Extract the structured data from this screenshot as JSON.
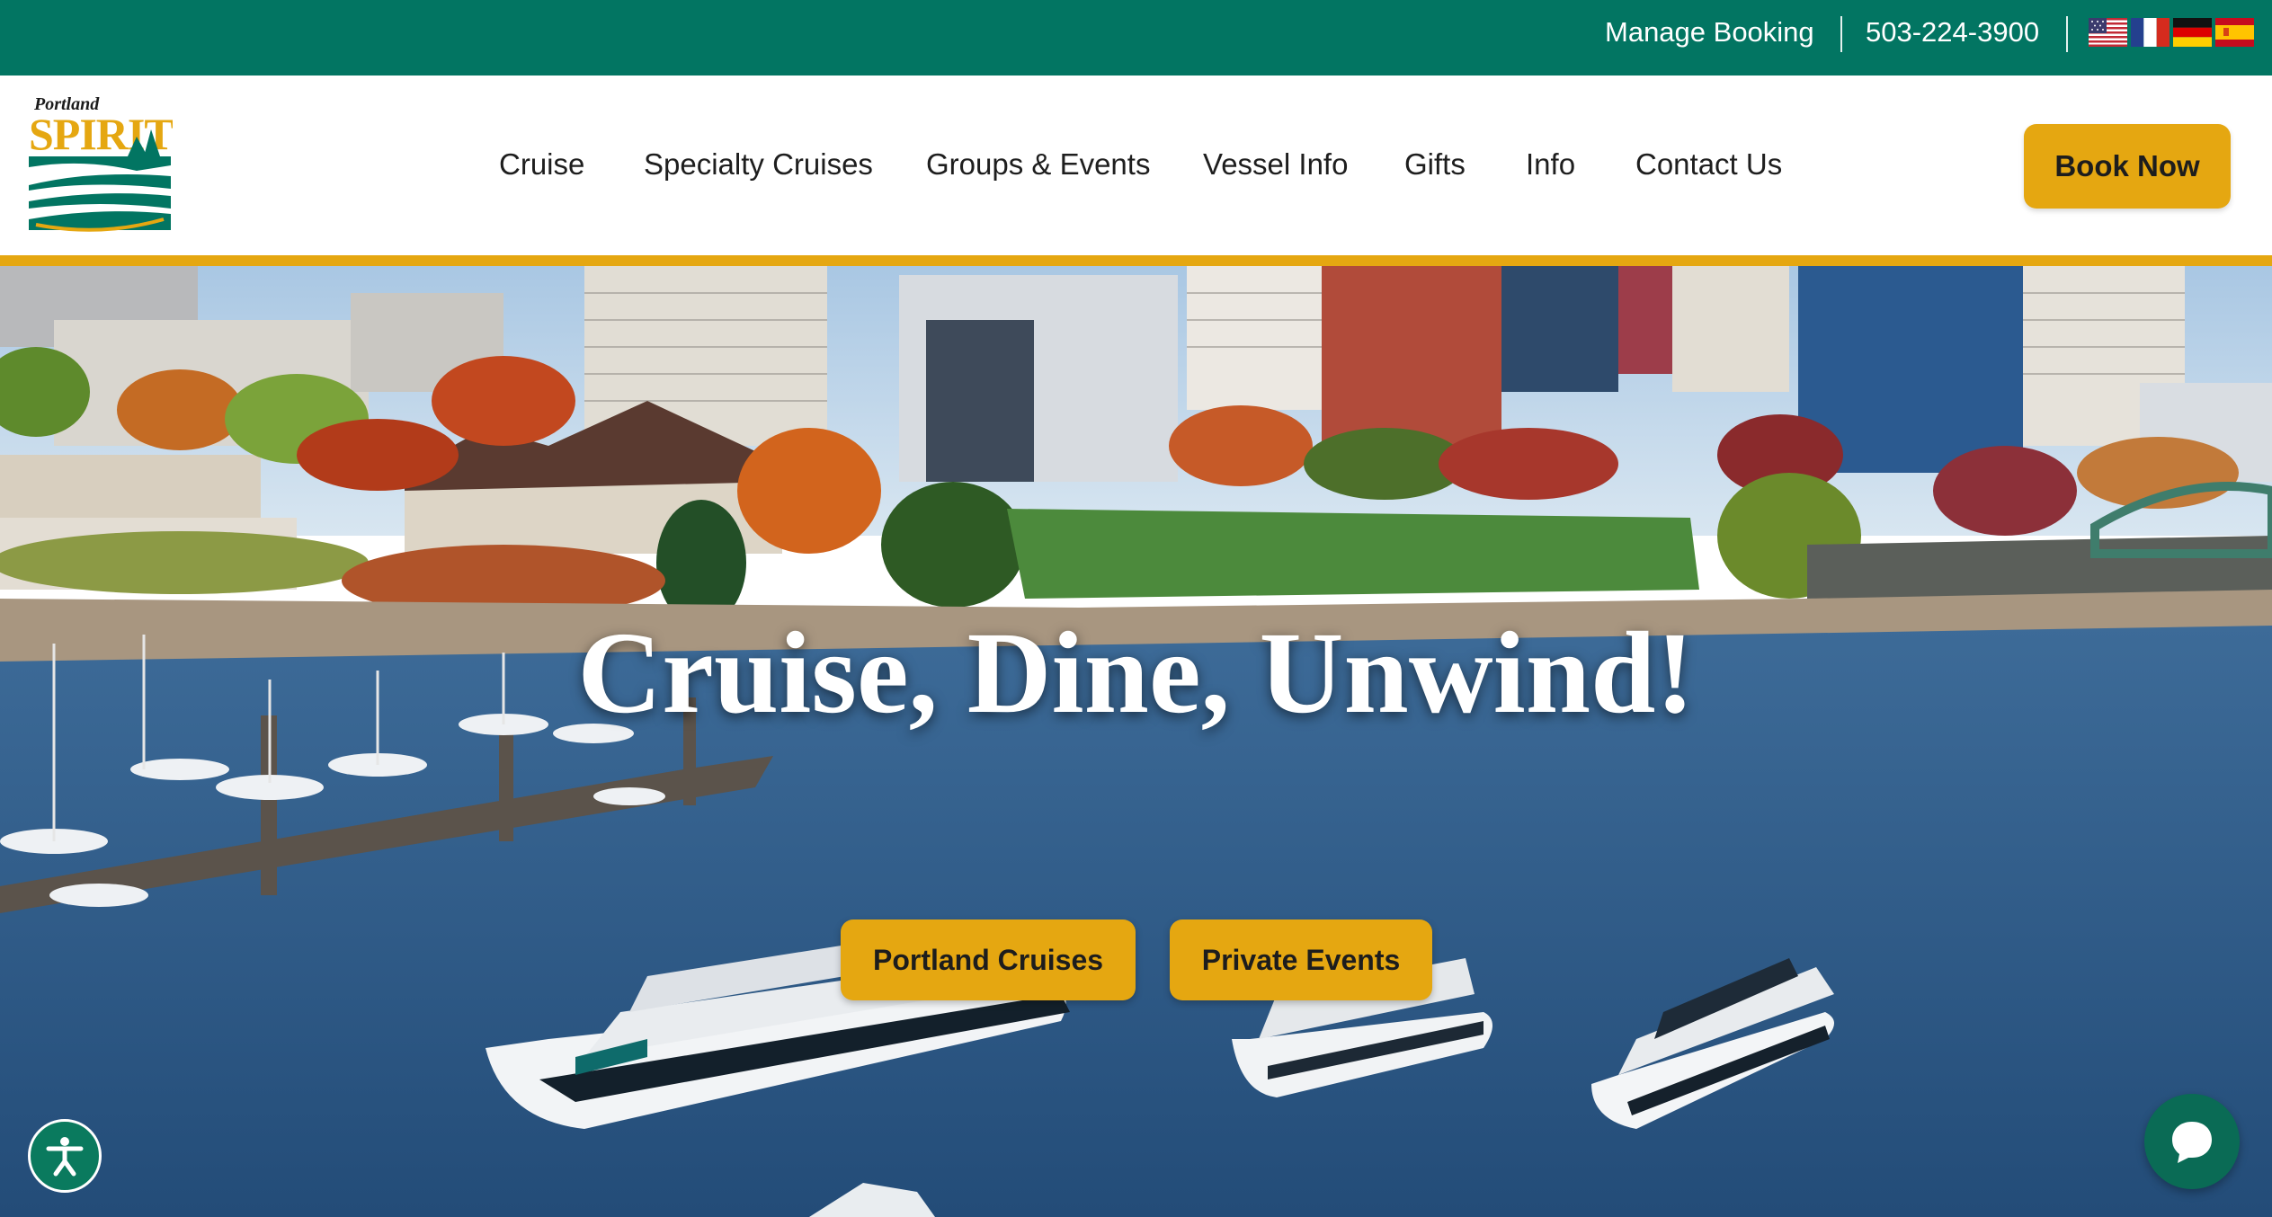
{
  "topbar": {
    "manage_booking": "Manage Booking",
    "phone": "503-224-3900",
    "languages": [
      "English",
      "French",
      "German",
      "Spanish"
    ]
  },
  "logo": {
    "line1": "Portland",
    "line2": "SPIRIT"
  },
  "nav": {
    "items": [
      {
        "label": "Cruise"
      },
      {
        "label": "Specialty Cruises"
      },
      {
        "label": "Groups & Events"
      },
      {
        "label": "Vessel Info"
      },
      {
        "label": "Gifts"
      },
      {
        "label": "Info"
      },
      {
        "label": "Contact Us"
      }
    ],
    "book_now": "Book Now"
  },
  "hero": {
    "headline": "Cruise, Dine, Unwind!",
    "cta_primary": "Portland Cruises",
    "cta_secondary": "Private Events"
  },
  "colors": {
    "brand_green": "#027562",
    "brand_gold": "#e5a711",
    "water_blue": "#2f5e8c",
    "lawn_green": "#4c8a3c"
  },
  "icons": {
    "accessibility": "accessibility-icon",
    "chat": "chat-icon"
  }
}
